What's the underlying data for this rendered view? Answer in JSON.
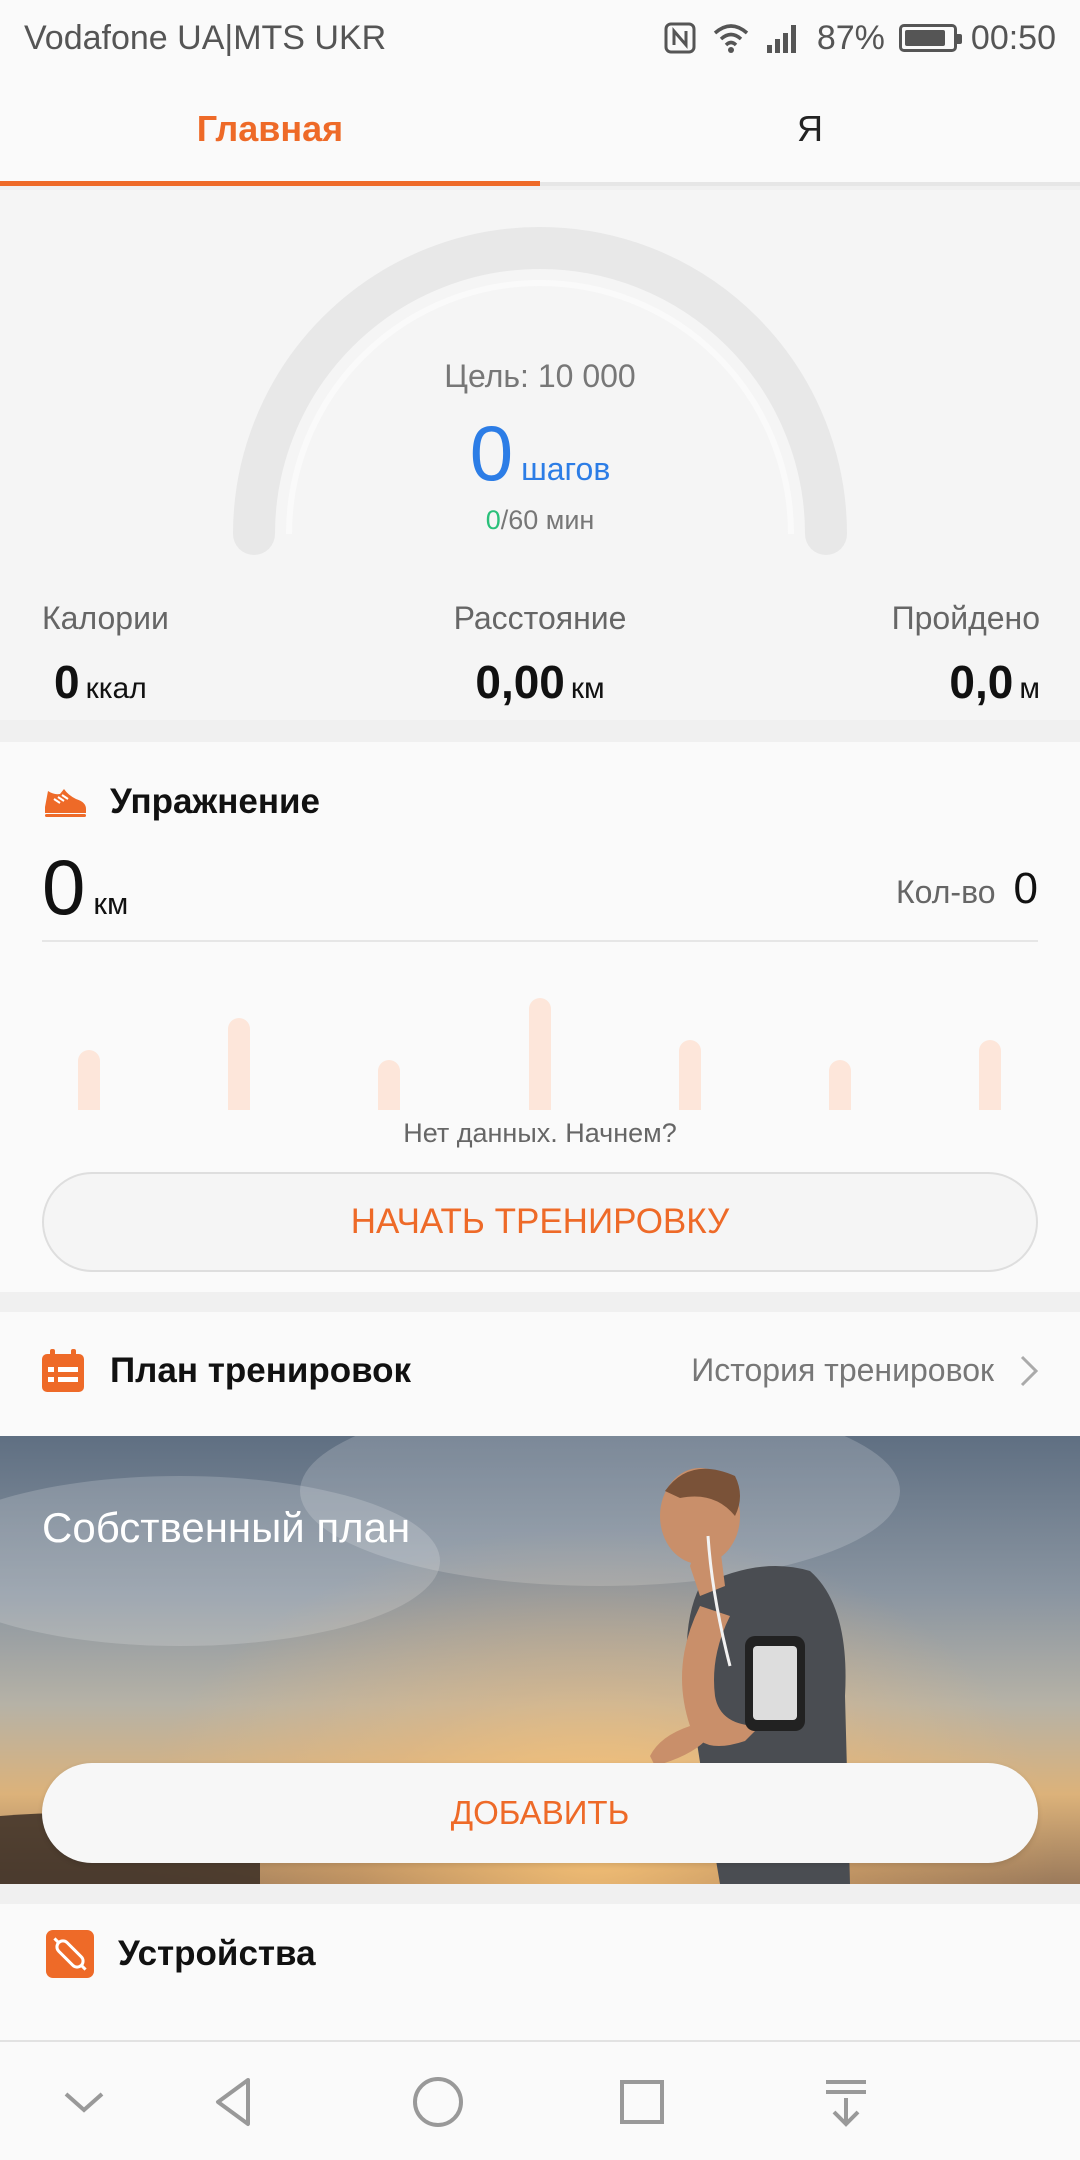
{
  "status_bar": {
    "carrier": "Vodafone UA|MTS UKR",
    "battery": "87%",
    "battery_level": 0.87,
    "time": "00:50",
    "icons": [
      "nfc-icon",
      "wifi-icon",
      "signal-icon",
      "battery-icon"
    ]
  },
  "tabs": [
    {
      "label": "Главная",
      "active": true
    },
    {
      "label": "Я",
      "active": false
    }
  ],
  "steps": {
    "goal": "Цель: 10 000",
    "count": "0",
    "unit": "шагов",
    "minutes_current": "0",
    "minutes_rest": "/60 мин",
    "progress": 0
  },
  "stats": [
    {
      "label": "Калории",
      "value": "0",
      "unit": "ккал"
    },
    {
      "label": "Расстояние",
      "value": "0,00",
      "unit": "км"
    },
    {
      "label": "Пройдено",
      "value": "0,0",
      "unit": "м"
    }
  ],
  "exercise": {
    "title": "Упражнение",
    "distance": "0",
    "distance_unit": "км",
    "count_label": "Кол-во",
    "count": "0",
    "no_data": "Нет данных. Начнем?",
    "start_button": "НАЧАТЬ ТРЕНИРОВКУ"
  },
  "plan": {
    "title": "План тренировок",
    "history_link": "История тренировок",
    "banner_title": "Собственный план",
    "add_button": "ДОБАВИТЬ"
  },
  "devices": {
    "title": "Устройства"
  },
  "colors": {
    "accent": "#ee6a28",
    "steps_blue": "#2c7de6",
    "minutes_green": "#2ac07a"
  }
}
